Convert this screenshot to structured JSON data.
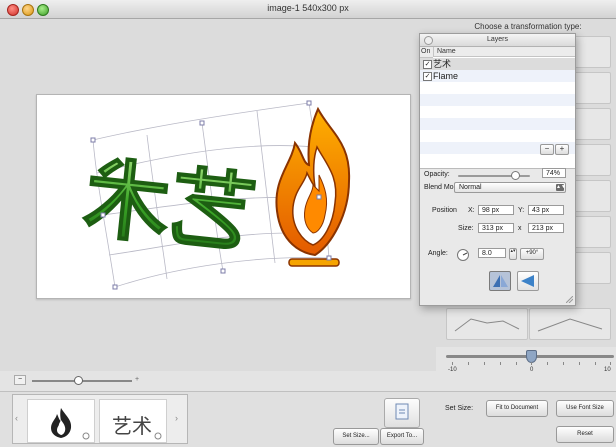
{
  "window": {
    "title": "image-1 540x300 px"
  },
  "right_panel": {
    "title": "Choose a transformation type:"
  },
  "layers_palette": {
    "title": "Layers",
    "columns": {
      "on": "On",
      "name": "Name"
    },
    "rows": [
      {
        "name": "艺术",
        "visible": true
      },
      {
        "name": "Flame",
        "visible": true
      }
    ],
    "remove_label": "−",
    "add_label": "+",
    "opacity_label": "Opacity:",
    "opacity_value": "74%",
    "opacity_fraction": 0.74,
    "blend_mode_label": "Blend Mode:",
    "blend_mode_value": "Normal",
    "position_label": "Position",
    "x_label": "X:",
    "x_value": "98 px",
    "y_label": "Y:",
    "y_value": "43 px",
    "size_label": "Size:",
    "width_value": "313 px",
    "size_sep": "x",
    "height_value": "213 px",
    "angle_label": "Angle:",
    "angle_value": "8.0",
    "rotate_label": "+90°"
  },
  "transform_scale": {
    "labels": [
      "-10",
      "0",
      "10"
    ],
    "value": 0
  },
  "zoom": {
    "minus": "−",
    "plus": "+"
  },
  "thumbnails": [
    {
      "label": "flame-icon"
    },
    {
      "label": "艺术"
    }
  ],
  "artwork": {
    "text": "艺术"
  },
  "bottom_bar": {
    "set_size_button": "Set Size...",
    "export_button": "Export To...",
    "set_size_label": "Set Size:",
    "fit_button": "Fit to Document",
    "use_font_button": "Use Font Size",
    "reset_button": "Reset"
  },
  "colors": {
    "accent": "#8fa6c4",
    "flame_outer": "#f08a00",
    "text_green": "#3aa526"
  }
}
